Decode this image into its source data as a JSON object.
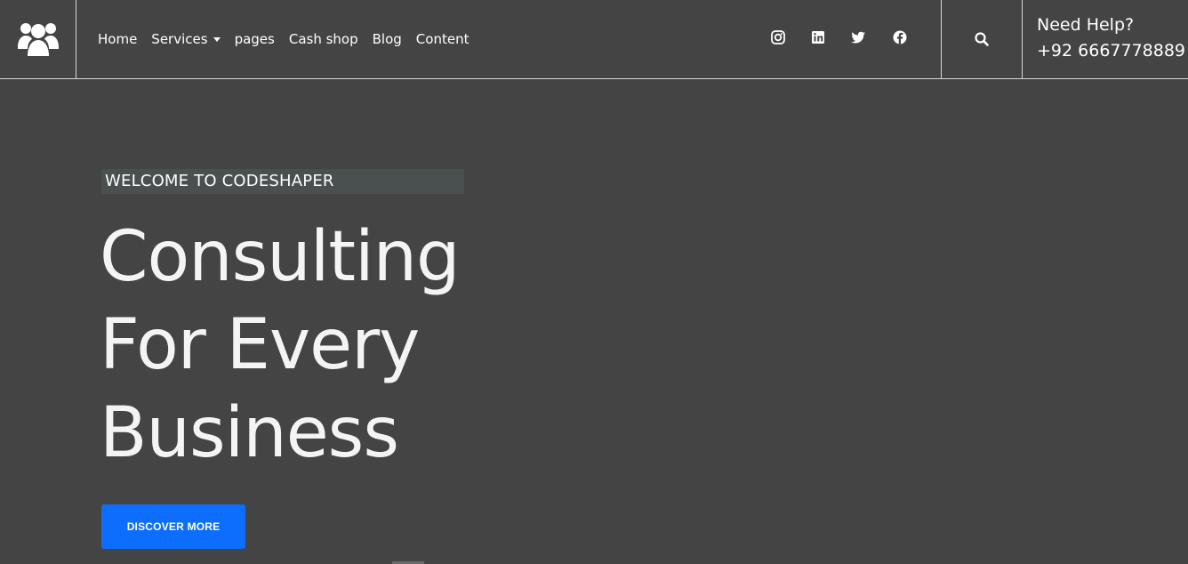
{
  "header": {
    "logo_icon": "users-group-icon",
    "nav": [
      {
        "label": "Home"
      },
      {
        "label": "Services",
        "has_dropdown": true
      },
      {
        "label": "pages"
      },
      {
        "label": "Cash shop"
      },
      {
        "label": "Blog"
      },
      {
        "label": "Content"
      }
    ],
    "socials": [
      "instagram-icon",
      "linkedin-icon",
      "twitter-icon",
      "facebook-icon"
    ],
    "search_icon": "search-icon",
    "help_title": "Need Help?",
    "help_phone": "+92 6667778889"
  },
  "hero": {
    "tagline": "WELCOME TO CODESHAPER",
    "title_lines": [
      "Consulting",
      "For Every",
      "Business"
    ],
    "cta_label": "DISCOVER MORE"
  },
  "colors": {
    "background": "#444444",
    "accent": "#0d6efd",
    "tag_background": "#4a4f50"
  }
}
